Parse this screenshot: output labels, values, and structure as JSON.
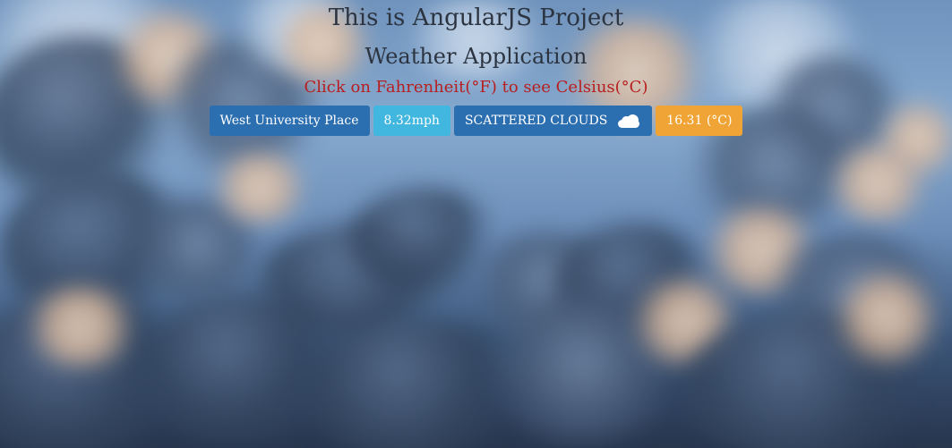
{
  "header": {
    "title": "This is AngularJS Project",
    "subtitle": "Weather Application",
    "hint": "Click on Fahrenheit(°F) to see Celsius(°C)"
  },
  "weather": {
    "location": "West University Place",
    "wind_speed": "8.32mph",
    "condition": "SCATTERED CLOUDS",
    "temperature": "16.31 (°C)"
  },
  "icons": {
    "condition_icon": "cloud-icon"
  },
  "colors": {
    "title": "#2b3440",
    "hint": "#b81e1e",
    "badge_primary": "#2c6fb1",
    "badge_info": "#41b6df",
    "badge_warning": "#f0a435"
  }
}
